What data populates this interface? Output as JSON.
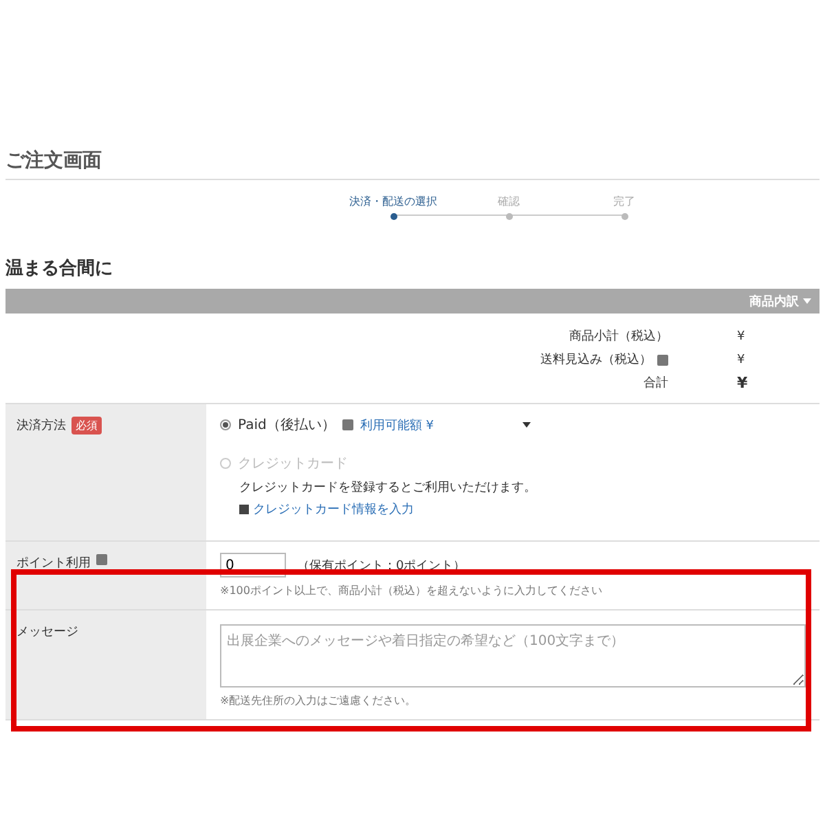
{
  "page_title": "ご注文画面",
  "steps": [
    {
      "label": "決済・配送の選択",
      "selected": true
    },
    {
      "label": "確認",
      "selected": false
    },
    {
      "label": "完了",
      "selected": false
    }
  ],
  "shop_name": "温まる合間に",
  "breakdown_toggle": "商品内訳",
  "summary": [
    {
      "label": "商品小計（税込）",
      "value": "¥",
      "help": false,
      "total": false
    },
    {
      "label": "送料見込み（税込）",
      "value": "¥",
      "help": true,
      "total": false
    },
    {
      "label": "合計",
      "value": "¥",
      "help": false,
      "total": true
    }
  ],
  "payment": {
    "label": "決済方法",
    "badge": "必須",
    "options": [
      {
        "label": "Paid（後払い）",
        "selected": true,
        "disabled": false,
        "help": true,
        "link": "利用可能額 ¥"
      },
      {
        "label": "クレジットカード",
        "selected": false,
        "disabled": true,
        "help": false,
        "note": "クレジットカードを登録するとご利用いただけます。",
        "link": "クレジットカード情報を入力"
      }
    ]
  },
  "points": {
    "label": "ポイント利用",
    "value": "0",
    "held": "（保有ポイント：0ポイント）",
    "note": "※100ポイント以上で、商品小計（税込）を超えないように入力してください"
  },
  "message": {
    "label": "メッセージ",
    "placeholder": "出展企業へのメッセージや着日指定の希望など（100文字まで）",
    "note": "※配送先住所の入力はご遠慮ください。"
  }
}
